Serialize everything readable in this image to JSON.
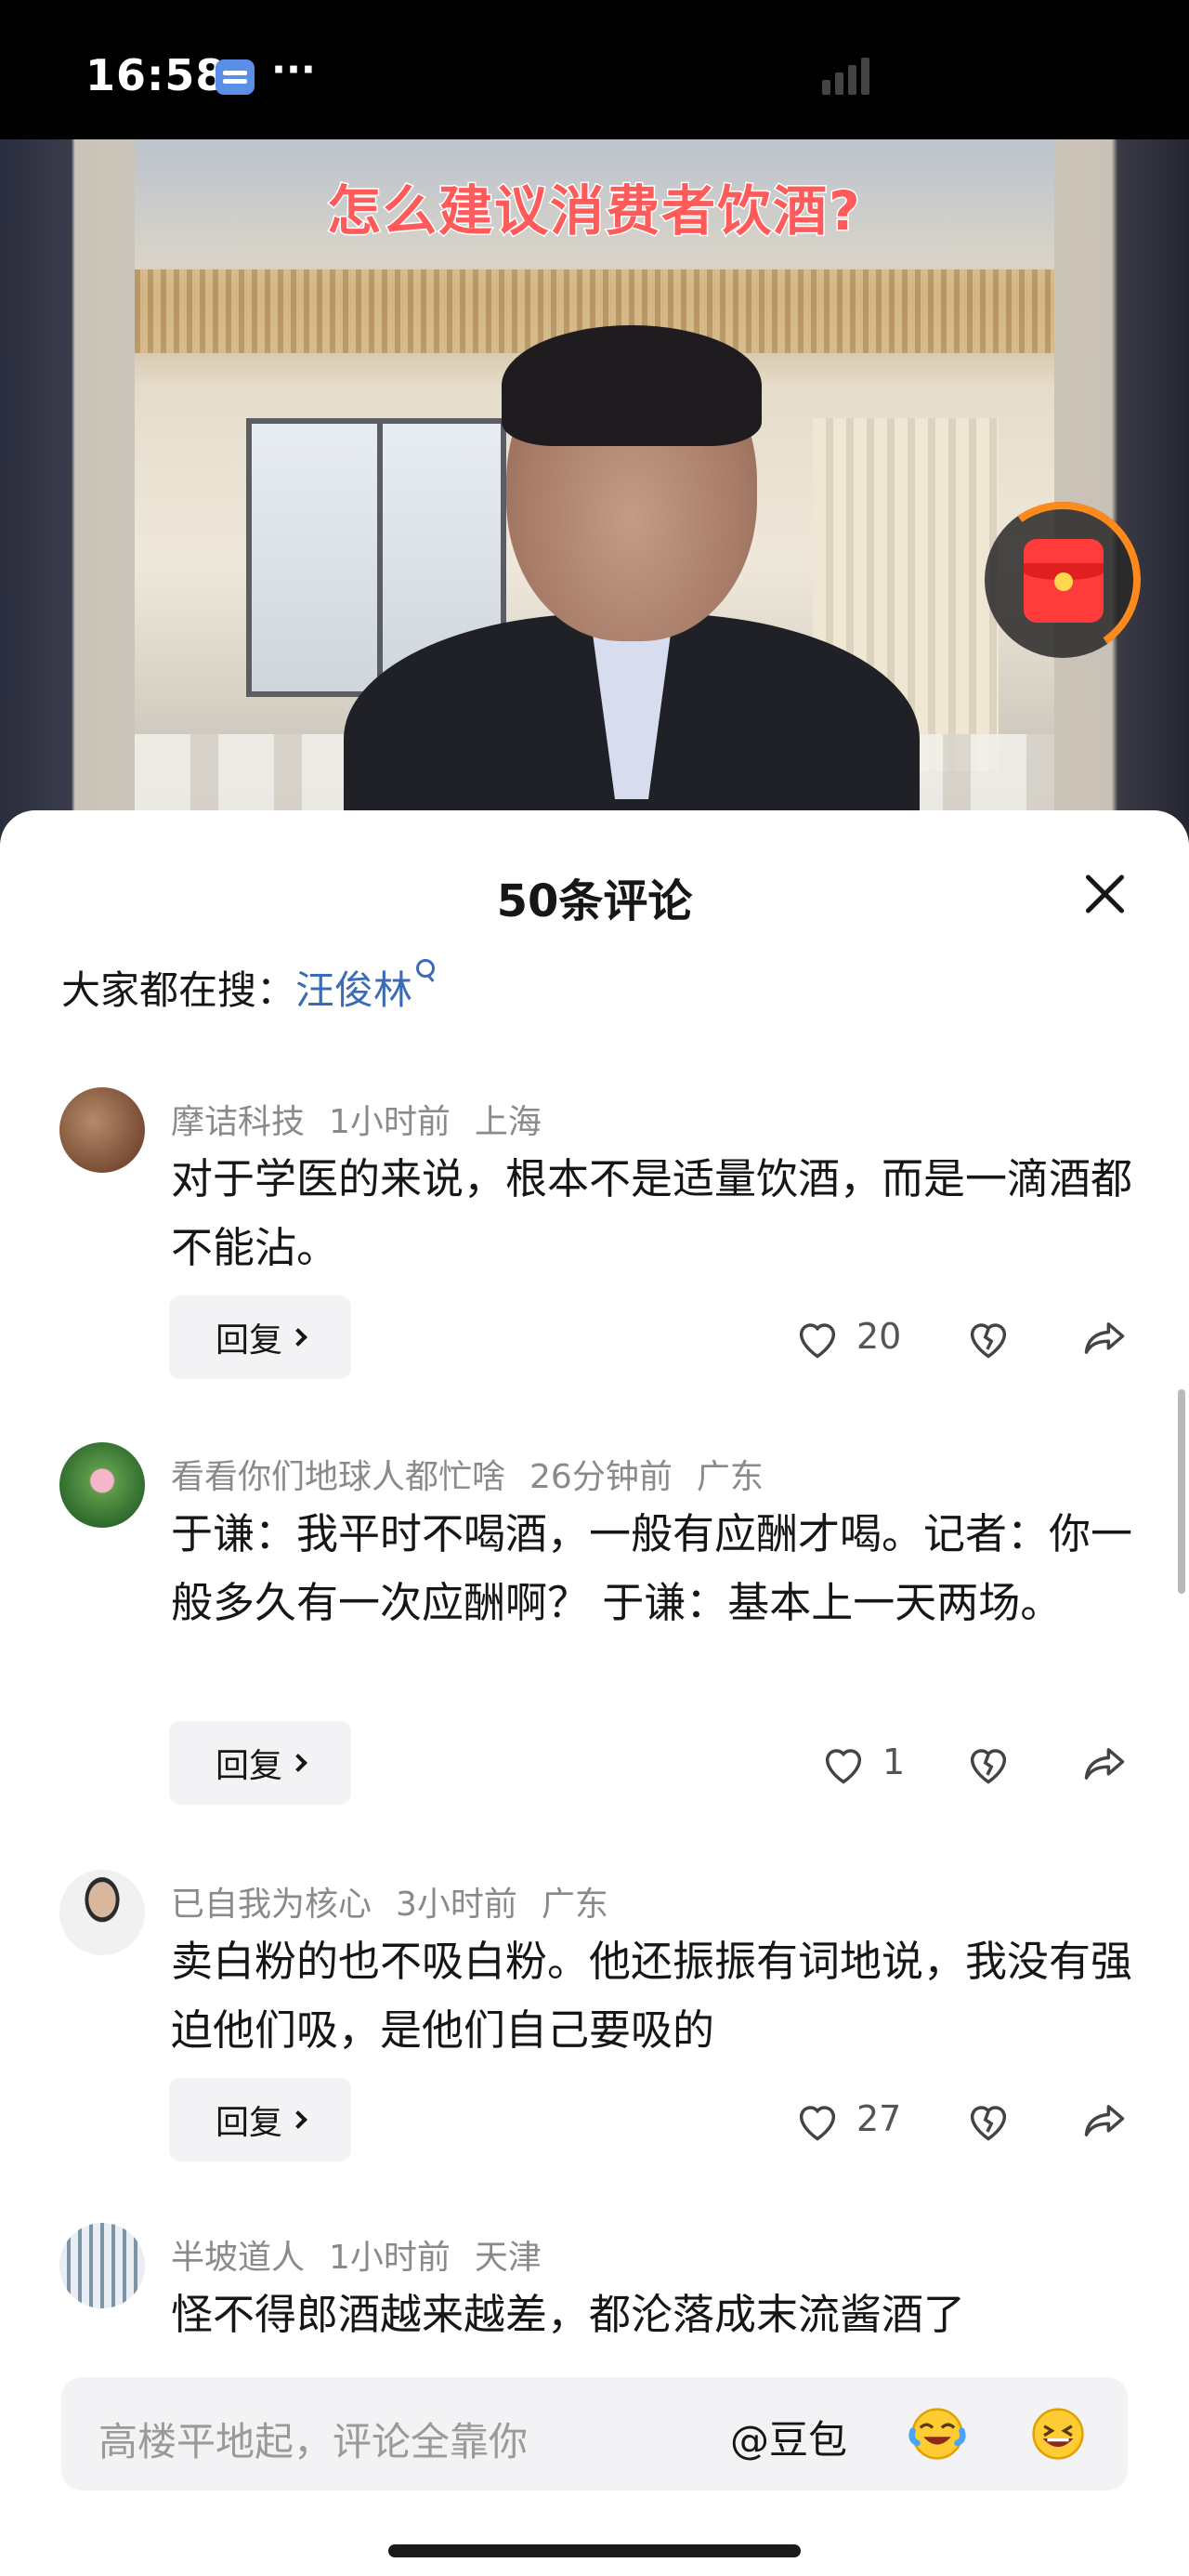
{
  "status_bar": {
    "time": "16:58",
    "more": "···"
  },
  "video": {
    "title": "怎么建议消费者饮酒?"
  },
  "comments_panel": {
    "title": "50条评论",
    "search_prefix": "大家都在搜：",
    "search_term": "汪俊林",
    "comments": [
      {
        "user": "摩诘科技",
        "time": "1小时前",
        "location": "上海",
        "text": "对于学医的来说，根本不是适量饮酒，而是一滴酒都不能沾。",
        "reply_label": "回复",
        "likes": "20"
      },
      {
        "user": "看看你们地球人都忙啥",
        "time": "26分钟前",
        "location": "广东",
        "text": "于谦：我平时不喝酒，一般有应酬才喝。记者：你一般多久有一次应酬啊？ 于谦：基本上一天两场。",
        "reply_label": "回复",
        "likes": "1"
      },
      {
        "user": "已自我为核心",
        "time": "3小时前",
        "location": "广东",
        "text": "卖白粉的也不吸白粉。他还振振有词地说，我没有强迫他们吸，是他们自己要吸的",
        "reply_label": "回复",
        "likes": "27"
      },
      {
        "user": "半坡道人",
        "time": "1小时前",
        "location": "天津",
        "text": "怪不得郎酒越来越差，都沦落成末流酱酒了"
      }
    ]
  },
  "input_bar": {
    "placeholder": "高楼平地起，评论全靠你",
    "mention": "@豆包"
  },
  "colors": {
    "accent_link": "#3c6bb5",
    "title_red": "#ff5b5b",
    "meta_gray": "#8a8a8a"
  }
}
